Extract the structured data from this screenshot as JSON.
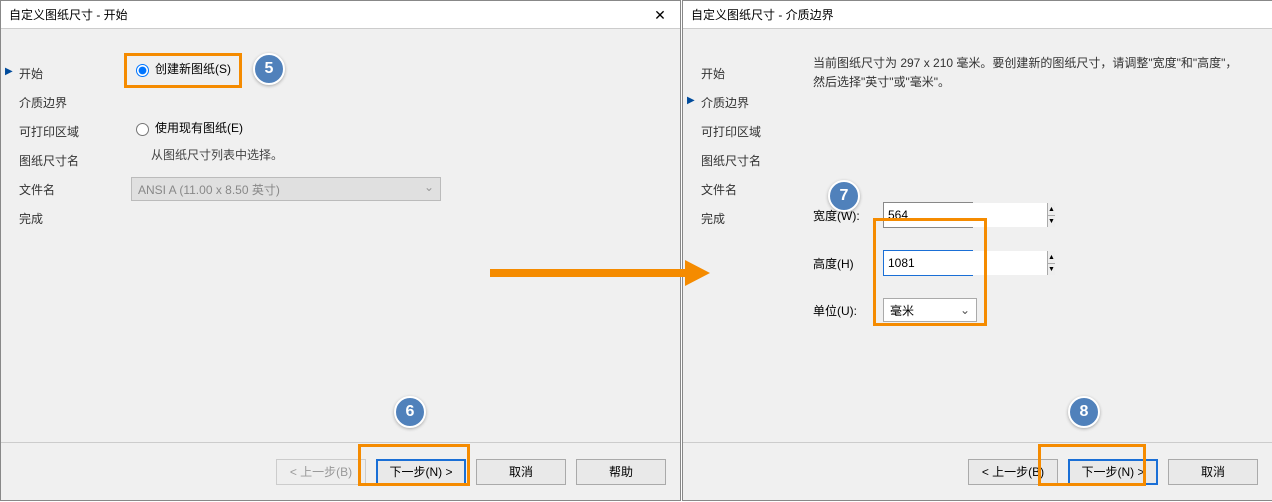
{
  "dialogLeft": {
    "title": "自定义图纸尺寸 - 开始",
    "sidebar": [
      "开始",
      "介质边界",
      "可打印区域",
      "图纸尺寸名",
      "文件名",
      "完成"
    ],
    "activeIndex": 0,
    "radio1": "创建新图纸(S)",
    "radio2": "使用现有图纸(E)",
    "helper": "从图纸尺寸列表中选择。",
    "combo": "ANSI A (11.00 x 8.50 英寸)",
    "footer": {
      "back": "< 上一步(B)",
      "next": "下一步(N) >",
      "cancel": "取消",
      "help": "帮助"
    }
  },
  "dialogRight": {
    "title": "自定义图纸尺寸 - 介质边界",
    "sidebar": [
      "开始",
      "介质边界",
      "可打印区域",
      "图纸尺寸名",
      "文件名",
      "完成"
    ],
    "activeIndex": 1,
    "info": "当前图纸尺寸为 297 x 210 毫米。要创建新的图纸尺寸，请调整\"宽度\"和\"高度\"，然后选择\"英寸\"或\"毫米\"。",
    "widthLabel": "宽度(W):",
    "widthValue": "564",
    "heightLabel": "高度(H)",
    "heightValue": "1081",
    "unitLabel": "单位(U):",
    "unitValue": "毫米",
    "footer": {
      "back": "< 上一步(B)",
      "next": "下一步(N) >",
      "cancel": "取消"
    }
  },
  "callouts": {
    "n5": "5",
    "n6": "6",
    "n7": "7",
    "n8": "8"
  }
}
